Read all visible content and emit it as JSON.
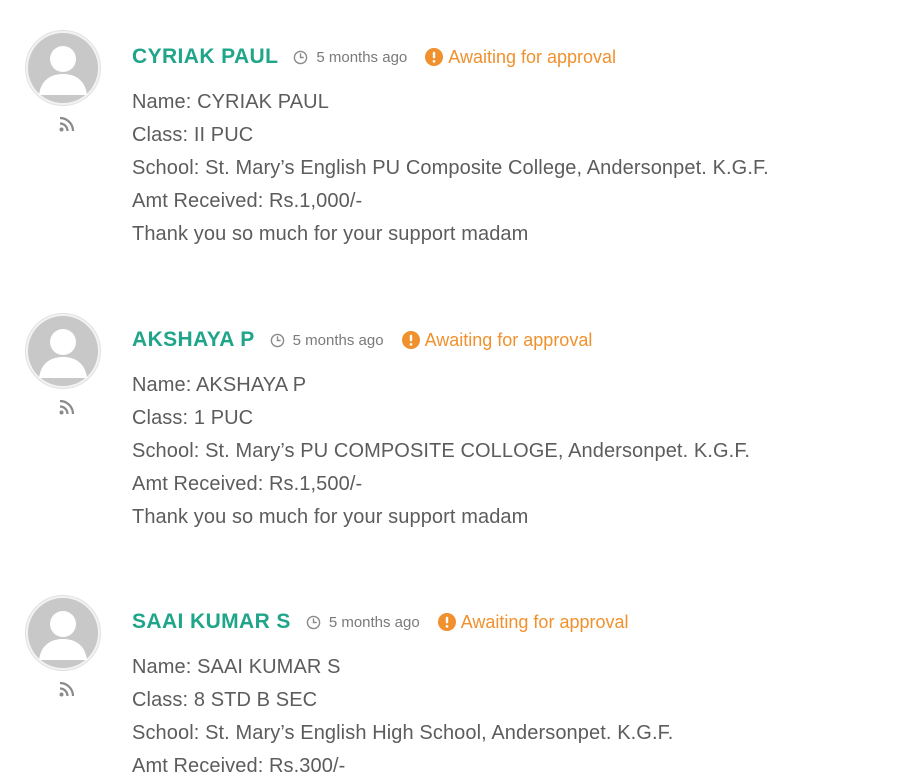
{
  "comments": [
    {
      "author": "CYRIAK PAUL",
      "time": "5 months ago",
      "status": "Awaiting for approval",
      "lines": [
        "Name: CYRIAK PAUL",
        "Class: II PUC",
        "School: St. Mary’s English PU Composite College, Andersonpet. K.G.F.",
        "Amt Received: Rs.1,000/-",
        "Thank you so much for your support madam"
      ]
    },
    {
      "author": "AKSHAYA P",
      "time": "5 months ago",
      "status": "Awaiting for approval",
      "lines": [
        "Name: AKSHAYA P",
        "Class: 1 PUC",
        "School: St. Mary’s PU COMPOSITE COLLOGE, Andersonpet. K.G.F.",
        "Amt Received: Rs.1,500/-",
        "Thank you so much for your support madam"
      ]
    },
    {
      "author": "SAAI KUMAR S",
      "time": "5 months ago",
      "status": "Awaiting for approval",
      "lines": [
        "Name: SAAI KUMAR S",
        "Class: 8 STD B SEC",
        "School: St. Mary’s English High School, Andersonpet. K.G.F.",
        "Amt Received: Rs.300/-"
      ]
    }
  ],
  "icons": {
    "avatar": "default-user-avatar-icon",
    "rss": "rss-feed-icon",
    "clock": "clock-icon",
    "warning": "exclamation-circle-icon"
  },
  "colors": {
    "author": "#1fa58a",
    "status": "#f0912e",
    "text": "#5c5c5c",
    "time": "#7a7a7a"
  }
}
